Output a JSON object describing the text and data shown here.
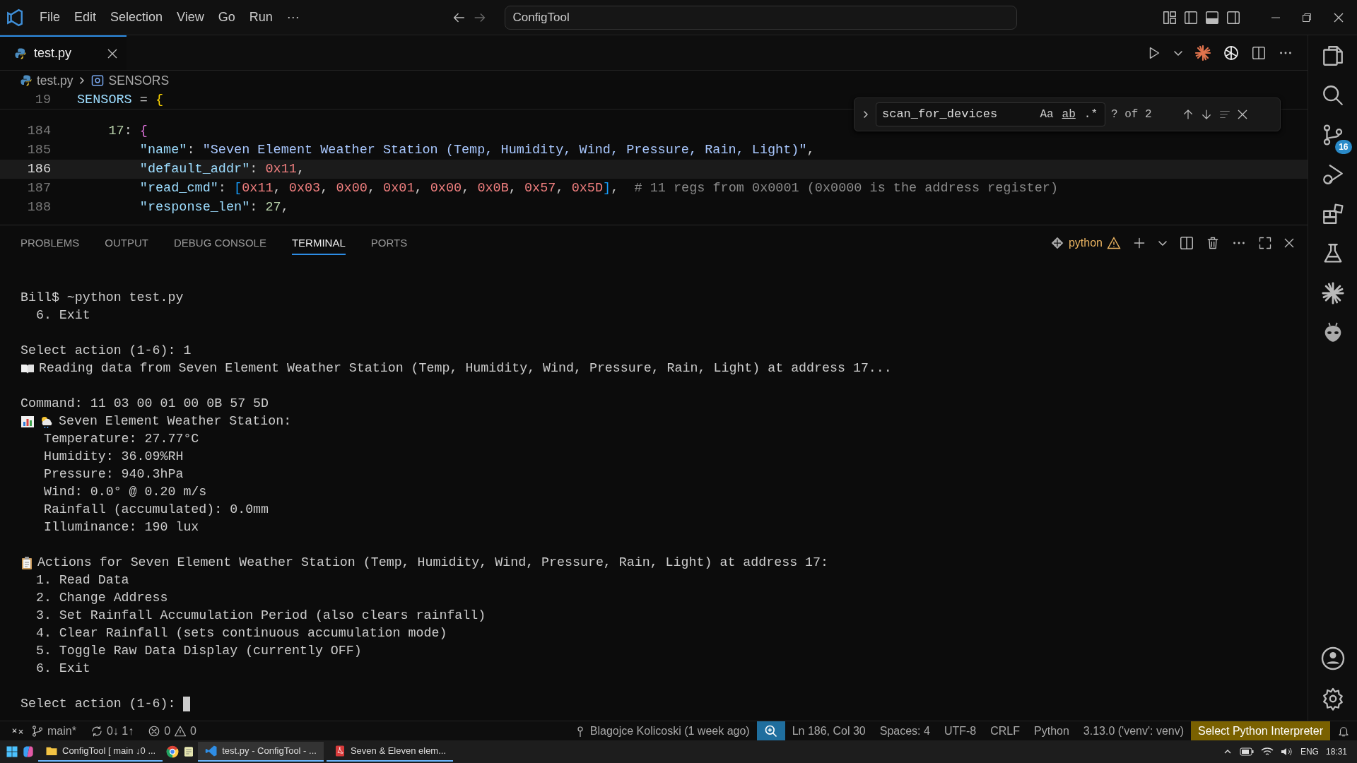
{
  "title_bar": {
    "menu": [
      "File",
      "Edit",
      "Selection",
      "View",
      "Go",
      "Run",
      "···"
    ],
    "search": "ConfigTool"
  },
  "editor_tabs": [
    {
      "label": "test.py",
      "selected": true
    }
  ],
  "breadcrumb": [
    "test.py",
    "SENSORS"
  ],
  "code": {
    "sticky": {
      "number": "19",
      "segments": [
        {
          "t": "SENSORS",
          "kind": "var"
        },
        {
          "t": " = ",
          "kind": "op"
        },
        {
          "t": "{",
          "kind": "brace"
        }
      ]
    },
    "lines": [
      {
        "number": "184",
        "current": false,
        "segments": [
          {
            "t": "    17",
            "kind": "num"
          },
          {
            "t": ": ",
            "kind": "op"
          },
          {
            "t": "{",
            "kind": "brace2"
          }
        ]
      },
      {
        "number": "185",
        "current": false,
        "segments": [
          {
            "t": "        \"name\"",
            "kind": "key"
          },
          {
            "t": ": ",
            "kind": "op"
          },
          {
            "t": "\"Seven Element Weather Station (Temp, Humidity, Wind, Pressure, Rain, Light)\"",
            "kind": "str"
          },
          {
            "t": ",",
            "kind": "op"
          }
        ]
      },
      {
        "number": "186",
        "current": true,
        "segments": [
          {
            "t": "        \"default_addr\"",
            "kind": "key"
          },
          {
            "t": ": ",
            "kind": "op"
          },
          {
            "t": "0x11",
            "kind": "hex"
          },
          {
            "t": ",",
            "kind": "op"
          }
        ]
      },
      {
        "number": "187",
        "current": false,
        "segments": [
          {
            "t": "        \"read_cmd\"",
            "kind": "key"
          },
          {
            "t": ": ",
            "kind": "op"
          },
          {
            "t": "[",
            "kind": "brace3"
          },
          {
            "t": "0x11",
            "kind": "hex"
          },
          {
            "t": ", ",
            "kind": "op"
          },
          {
            "t": "0x03",
            "kind": "hex"
          },
          {
            "t": ", ",
            "kind": "op"
          },
          {
            "t": "0x00",
            "kind": "hex"
          },
          {
            "t": ", ",
            "kind": "op"
          },
          {
            "t": "0x01",
            "kind": "hex"
          },
          {
            "t": ", ",
            "kind": "op"
          },
          {
            "t": "0x00",
            "kind": "hex"
          },
          {
            "t": ", ",
            "kind": "op"
          },
          {
            "t": "0x0B",
            "kind": "hex"
          },
          {
            "t": ", ",
            "kind": "op"
          },
          {
            "t": "0x57",
            "kind": "hex"
          },
          {
            "t": ", ",
            "kind": "op"
          },
          {
            "t": "0x5D",
            "kind": "hex"
          },
          {
            "t": "]",
            "kind": "brace3"
          },
          {
            "t": ",  ",
            "kind": "op"
          },
          {
            "t": "# 11 regs from 0x0001 (0x0000 is the address register)",
            "kind": "comment"
          }
        ]
      },
      {
        "number": "188",
        "current": false,
        "segments": [
          {
            "t": "        \"response_len\"",
            "kind": "key"
          },
          {
            "t": ": ",
            "kind": "op"
          },
          {
            "t": "27",
            "kind": "num"
          },
          {
            "t": ",",
            "kind": "op"
          }
        ]
      }
    ]
  },
  "find_widget": {
    "query": "scan_for_devices",
    "options": [
      "Aa",
      "ab",
      ".*"
    ],
    "result": "? of 2"
  },
  "panel": {
    "tabs": [
      {
        "label": "PROBLEMS",
        "selected": false
      },
      {
        "label": "OUTPUT",
        "selected": false
      },
      {
        "label": "DEBUG CONSOLE",
        "selected": false
      },
      {
        "label": "TERMINAL",
        "selected": true
      },
      {
        "label": "PORTS",
        "selected": false
      }
    ],
    "terminal_name": "python"
  },
  "terminal": [
    {
      "kind": "text",
      "text": "Bill$ ~python test.py"
    },
    {
      "kind": "text",
      "text": "  6. Exit"
    },
    {
      "kind": "blank"
    },
    {
      "kind": "text",
      "text": "Select action (1-6): 1"
    },
    {
      "kind": "reading",
      "text": "Reading data from Seven Element Weather Station (Temp, Humidity, Wind, Pressure, Rain, Light) at address 17..."
    },
    {
      "kind": "blank"
    },
    {
      "kind": "text",
      "text": "Command: 11 03 00 01 00 0B 57 5D"
    },
    {
      "kind": "readout",
      "text": "Seven Element Weather Station:"
    },
    {
      "kind": "text",
      "text": "   Temperature: 27.77°C"
    },
    {
      "kind": "text",
      "text": "   Humidity: 36.09%RH"
    },
    {
      "kind": "text",
      "text": "   Pressure: 940.3hPa"
    },
    {
      "kind": "text",
      "text": "   Wind: 0.0° @ 0.20 m/s"
    },
    {
      "kind": "text",
      "text": "   Rainfall (accumulated): 0.0mm"
    },
    {
      "kind": "text",
      "text": "   Illuminance: 190 lux"
    },
    {
      "kind": "blank"
    },
    {
      "kind": "actions",
      "text": "Actions for Seven Element Weather Station (Temp, Humidity, Wind, Pressure, Rain, Light) at address 17:"
    },
    {
      "kind": "text",
      "text": "  1. Read Data"
    },
    {
      "kind": "text",
      "text": "  2. Change Address"
    },
    {
      "kind": "text",
      "text": "  3. Set Rainfall Accumulation Period (also clears rainfall)"
    },
    {
      "kind": "text",
      "text": "  4. Clear Rainfall (sets continuous accumulation mode)"
    },
    {
      "kind": "text",
      "text": "  5. Toggle Raw Data Display (currently OFF)"
    },
    {
      "kind": "text",
      "text": "  6. Exit"
    },
    {
      "kind": "blank"
    },
    {
      "kind": "prompt",
      "text": "Select action (1-6): "
    }
  ],
  "activity_bar": {
    "badge": "16"
  },
  "status_bar": {
    "branch": "main*",
    "sync": "0↓ 1↑",
    "errors": "0",
    "warnings": "0",
    "blame": "Blagojce Kolicoski (1 week ago)",
    "position": "Ln 186, Col 30",
    "indent": "Spaces: 4",
    "encoding": "UTF-8",
    "eol": "CRLF",
    "language": "Python",
    "interpreter": "3.13.0 ('venv': venv)",
    "interpreter_warning": "Select Python Interpreter"
  },
  "taskbar": {
    "items": [
      {
        "label": "ConfigTool [ main ↓0 ...",
        "selected": false
      },
      {
        "label": "test.py - ConfigTool - ...",
        "selected": true
      },
      {
        "label": "Seven & Eleven elem...",
        "selected": false
      }
    ],
    "language": "ENG",
    "time": "18:31"
  }
}
